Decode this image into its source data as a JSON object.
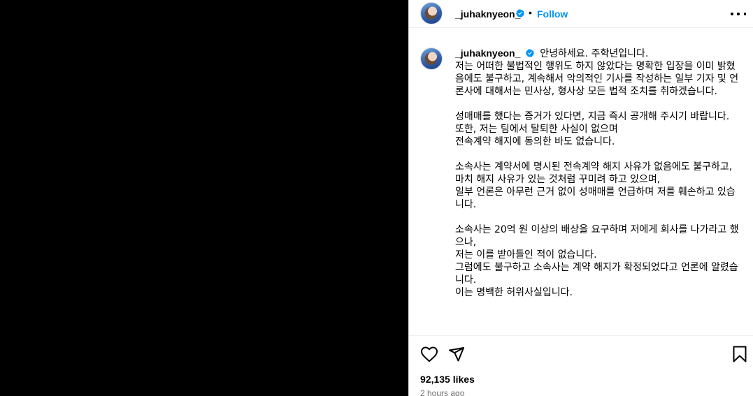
{
  "post": {
    "username": "_juhaknyeon_",
    "follow_label": "Follow",
    "separator": "•",
    "colors": {
      "accent": "#0095f6",
      "verified": "#0095f6",
      "media_bg": "#000000",
      "muted": "#737373"
    },
    "icons": [
      "avatar",
      "verified-badge-icon",
      "more-options-icon",
      "heart-icon",
      "share-icon",
      "bookmark-icon"
    ]
  },
  "caption": {
    "username": "_juhaknyeon_",
    "first_line": "안녕하세요. 주학년입니다.",
    "lines": [
      "저는 어떠한 불법적인 행위도 하지 않았다는 명확한 입장을 이미 밝혔음에도 불구하고, 계속해서 악의적인 기사를 작성하는 일부 기자 및 언론사에 대해서는 민사상, 형사상 모든 법적 조치를 취하겠습니다.",
      "",
      "성매매를 했다는 증거가 있다면, 지금 즉시 공개해 주시기 바랍니다.",
      "또한, 저는 팀에서 탈퇴한 사실이 없으며",
      "전속계약 해지에 동의한 바도 없습니다.",
      "",
      "소속사는 계약서에 명시된 전속계약 해지 사유가 없음에도 불구하고,",
      "마치 해지 사유가 있는 것처럼 꾸미려 하고 있으며,",
      "일부 언론은 아무런 근거 없이 성매매를 언급하며 저를 훼손하고 있습니다.",
      "",
      "소속사는 20억 원 이상의 배상을 요구하며 저에게 회사를 나가라고 했으나,",
      "저는 이를 받아들인 적이 없습니다.",
      "그럼에도 불구하고 소속사는 계약 해지가 확정되었다고 언론에 알렸습니다.",
      "이는 명백한 허위사실입니다."
    ]
  },
  "engagement": {
    "likes_count": "92,135",
    "likes_suffix": " likes",
    "timestamp": "2 hours ago"
  }
}
